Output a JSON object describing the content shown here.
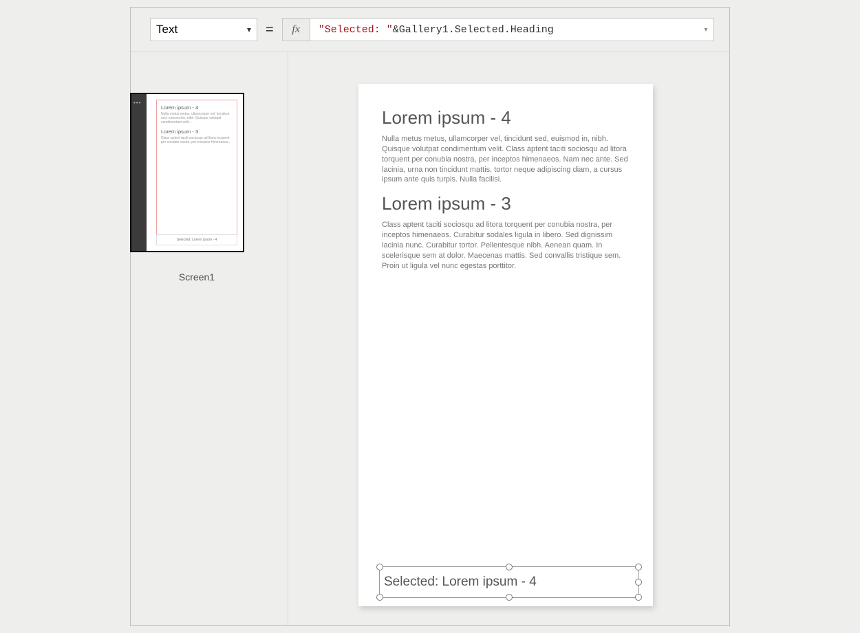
{
  "formula_bar": {
    "property": "Text",
    "equals": "=",
    "fx_label": "fx",
    "formula_string": "\"Selected: \"",
    "formula_op": " & ",
    "formula_ref": "Gallery1.Selected.Heading"
  },
  "sidebar": {
    "screen_name": "Screen1",
    "thumb": {
      "h1": "Lorem ipsum - 4",
      "d1": "Nulla metus metus, ullamcorper vel, tincidunt sed, euismod in, nibh. Quisque volutpat condimentum velit...",
      "h2": "Lorem ipsum - 3",
      "d2": "Class aptent taciti sociosqu ad litora torquent per conubia nostra, per inceptos himenaeos...",
      "sel": "Selected: Lorem ipsum - 4"
    }
  },
  "canvas": {
    "gallery": [
      {
        "heading": "Lorem ipsum - 4",
        "desc": "Nulla metus metus, ullamcorper vel, tincidunt sed, euismod in, nibh. Quisque volutpat condimentum velit. Class aptent taciti sociosqu ad litora torquent per conubia nostra, per inceptos himenaeos. Nam nec ante. Sed lacinia, urna non tincidunt mattis, tortor neque adipiscing diam, a cursus ipsum ante quis turpis. Nulla facilisi."
      },
      {
        "heading": "Lorem ipsum - 3",
        "desc": "Class aptent taciti sociosqu ad litora torquent per conubia nostra, per inceptos himenaeos. Curabitur sodales ligula in libero. Sed dignissim lacinia nunc. Curabitur tortor. Pellentesque nibh. Aenean quam. In scelerisque sem at dolor. Maecenas mattis. Sed convallis tristique sem. Proin ut ligula vel nunc egestas porttitor."
      }
    ],
    "selected_label": "Selected: Lorem ipsum - 4"
  }
}
